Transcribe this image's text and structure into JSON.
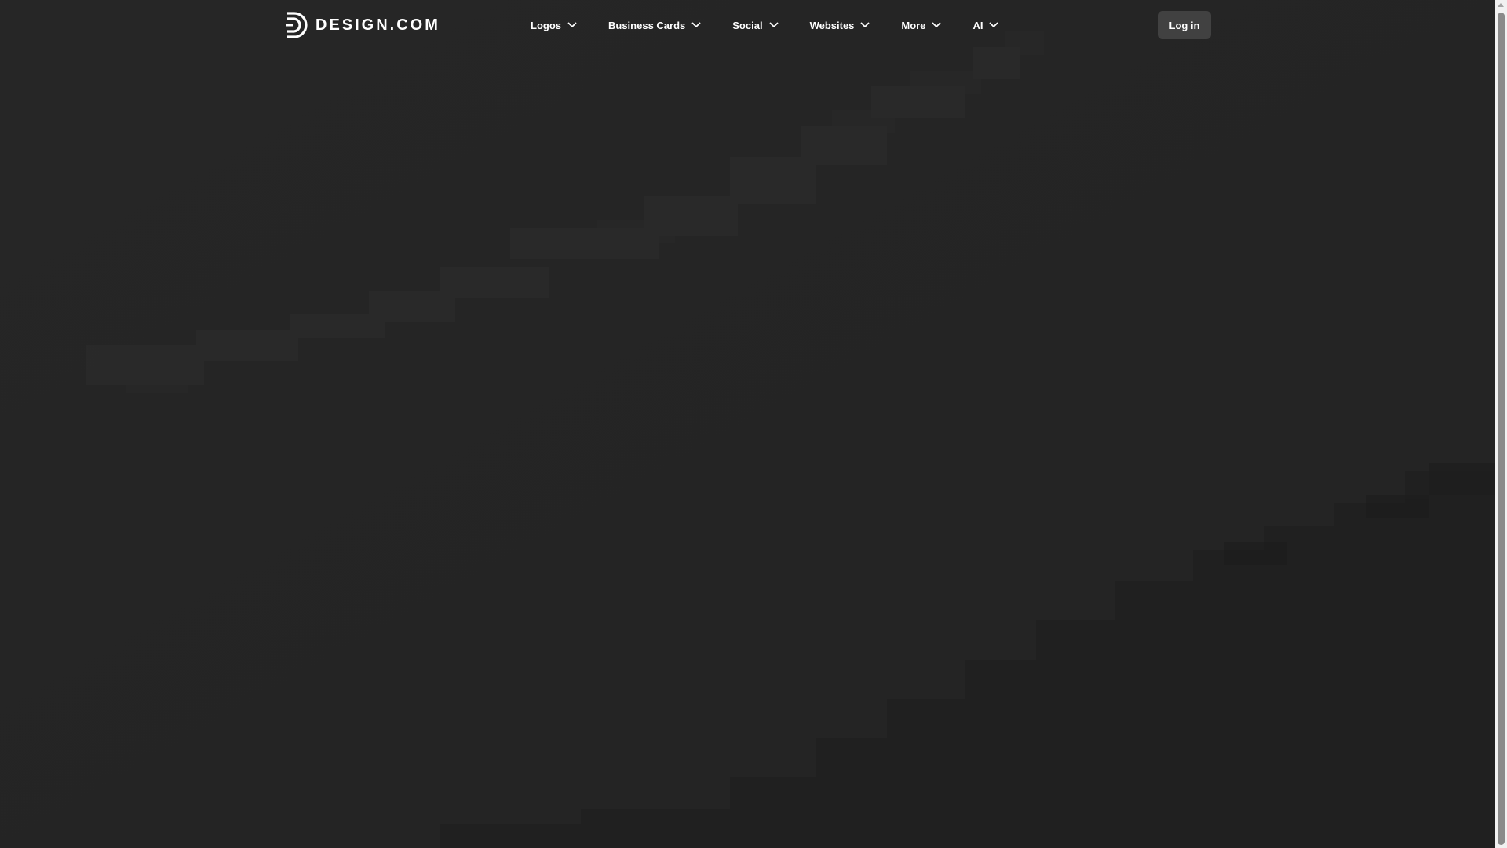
{
  "brand": {
    "name": "DESIGN.COM",
    "icon": "design-com-logo-icon"
  },
  "nav": {
    "items": [
      {
        "label": "Logos",
        "icon": "chevron-down-icon"
      },
      {
        "label": "Business Cards",
        "icon": "chevron-down-icon"
      },
      {
        "label": "Social",
        "icon": "chevron-down-icon"
      },
      {
        "label": "Websites",
        "icon": "chevron-down-icon"
      },
      {
        "label": "More",
        "icon": "chevron-down-icon"
      },
      {
        "label": "AI",
        "icon": "chevron-down-icon"
      }
    ],
    "login_label": "Log in"
  },
  "colors": {
    "background": "#262626",
    "nav_text": "#ffffff",
    "login_bg": "#414141",
    "scrollbar_track": "#f1f1f1",
    "scrollbar_thumb": "#8a8a8a"
  }
}
